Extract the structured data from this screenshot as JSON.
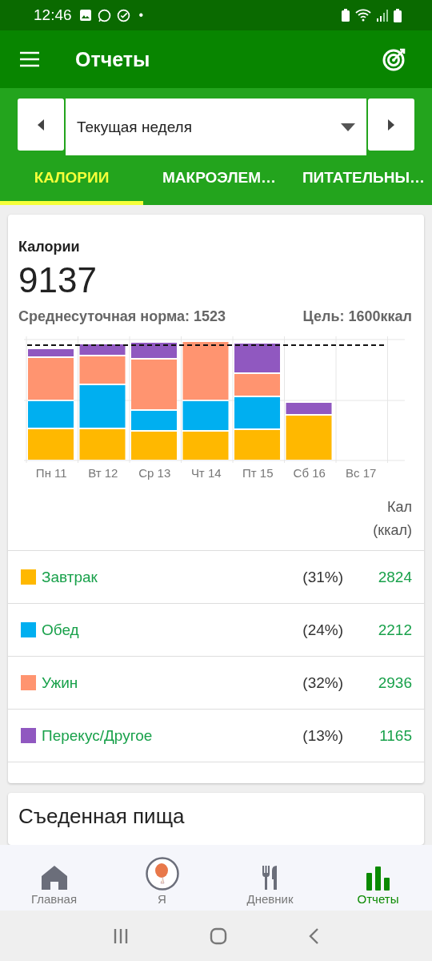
{
  "status_bar": {
    "time": "12:46",
    "dot": "•"
  },
  "app_bar": {
    "title": "Отчеты"
  },
  "period": {
    "value": "Текущая неделя"
  },
  "tabs": [
    {
      "label": "КАЛОРИИ",
      "selected": true
    },
    {
      "label": "МАКРОЭЛЕМ…",
      "selected": false
    },
    {
      "label": "ПИТАТЕЛЬНЫ…",
      "selected": false
    }
  ],
  "summary": {
    "title": "Калории",
    "total": "9137",
    "average": "Среднесуточная норма: 1523",
    "goal": "Цель: 1600ккал"
  },
  "chart_days": [
    "Пн 11",
    "Вт 12",
    "Ср 13",
    "Чт 14",
    "Пт 15",
    "Сб 16",
    "Вс 17"
  ],
  "table": {
    "column_header": "Кал (ккал)",
    "rows": [
      {
        "name": "Завтрак",
        "percent": "(31%)",
        "value": "2824",
        "color": "#ffb800"
      },
      {
        "name": "Обед",
        "percent": "(24%)",
        "value": "2212",
        "color": "#00aff0"
      },
      {
        "name": "Ужин",
        "percent": "(32%)",
        "value": "2936",
        "color": "#ff9470"
      },
      {
        "name": "Перекус/Другое",
        "percent": "(13%)",
        "value": "1165",
        "color": "#9058c0"
      }
    ]
  },
  "next_card": {
    "title": "Съеденная пища"
  },
  "bottom_nav": [
    {
      "label": "Главная",
      "kind": "home",
      "selected": false
    },
    {
      "label": "Я",
      "kind": "avatar",
      "selected": false
    },
    {
      "label": "Дневник",
      "kind": "diary",
      "selected": false
    },
    {
      "label": "Отчеты",
      "kind": "reports",
      "selected": true
    }
  ]
}
